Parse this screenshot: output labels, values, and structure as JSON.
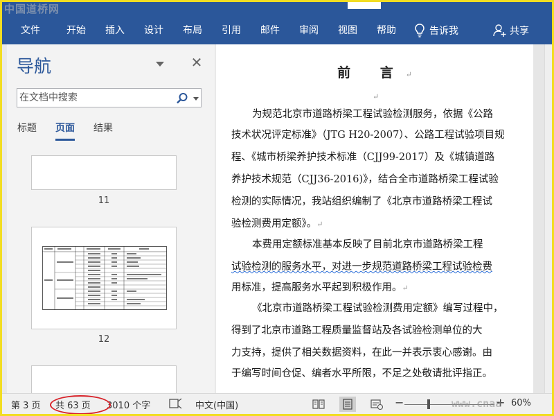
{
  "watermark": {
    "top_text": "中国道桥网",
    "bottom_text": "www.cnaa"
  },
  "ribbon": {
    "tabs": [
      "文件",
      "开始",
      "插入",
      "设计",
      "布局",
      "引用",
      "邮件",
      "审阅",
      "视图",
      "帮助"
    ],
    "tell_me": "告诉我",
    "share": "共享"
  },
  "nav": {
    "title": "导航",
    "search_placeholder": "在文档中搜索",
    "tabs": [
      "标题",
      "页面",
      "结果"
    ],
    "active_tab": "页面",
    "pages": [
      "11",
      "12"
    ]
  },
  "document": {
    "title": "前    言",
    "paragraph_mark": "↵",
    "lines": [
      "为规范北京市道路桥梁工程试验检测服务，依据《公路",
      "技术状况评定标准》（JTG H20-2007）、公路工程试验项目规",
      "程、《城市桥梁养护技术标准（CJJ99-2017）及《城镇道路",
      "养护技术规范（CJJ36-2016)》，结合全市道路桥梁工程试验",
      "检测的实际情况，我站组织编制了《北京市道路桥梁工程试",
      "验检测费用定额》。",
      "本费用定额标准基本反映了目前北京市道路桥梁工程",
      "试验检测的服务水平，对进一步规范道路桥梁工程试验检费",
      "用标准，提高服务水平起到积极作用。",
      "《北京市道路桥梁工程试验检测费用定额》编写过程中，",
      "得到了北京市道路工程质量监督站及各试验检测单位的大",
      "力支持，提供了相关数据资料，在此一并表示衷心感谢。由",
      "于编写时间仓促、编者水平所限，不足之处敬请批评指正。"
    ]
  },
  "status": {
    "page": "第 3 页",
    "total_pages": "共 63 页",
    "word_count": "3010 个字",
    "language": "中文(中国)",
    "zoom": "60%"
  },
  "colors": {
    "ribbon": "#2b579a",
    "accent": "#2b579a",
    "highlight_oval": "#d8232a"
  }
}
